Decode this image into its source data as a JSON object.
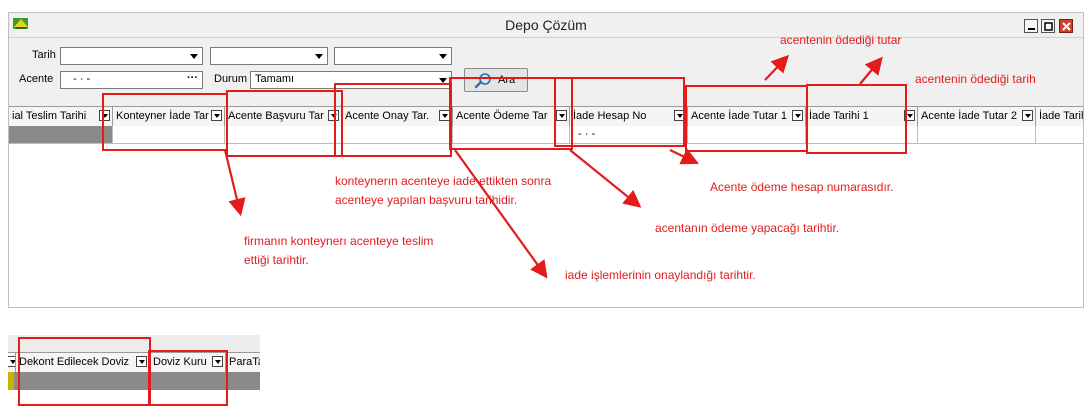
{
  "window": {
    "title": "Depo Çözüm"
  },
  "filters": {
    "date_label": "Tarih",
    "date_combo_1": "",
    "date_combo_2": "",
    "date_combo_3": "",
    "agency_label": "Acente",
    "agency_value": "- · -",
    "agency_browse": "···",
    "status_label": "Durum",
    "status_value": "Tamamı",
    "search_button": "Ara"
  },
  "grid": {
    "columns": [
      "ial Teslim Tarihi",
      "Konteyner İade Tar",
      "Acente Başvuru Tar",
      "Acente Onay Tar.",
      "Acente Ödeme Tar",
      "İade Hesap No",
      "Acente İade Tutar 1",
      "İade Tarihi 1",
      "Acente İade Tutar 2",
      "İade Tarih"
    ],
    "row_value_iade_hesap": "- · -"
  },
  "grid2": {
    "columns": [
      "Dekont Edilecek Doviz",
      "Doviz Kuru",
      "ParaTa"
    ]
  },
  "annotations": {
    "paid_amount": "acentenin ödediği tutar",
    "paid_date": "acentenin ödediği tarih",
    "application_date_line1": "konteynerın acenteye iade ettikten sonra",
    "application_date_line2": "acenteye yapılan başvuru tarihidir.",
    "account_no": "Acente ödeme hesap numarasıdır.",
    "payment_date": "acentanın ödeme yapacağı tarihtir.",
    "delivery_line1": "firmanın konteynerı acenteye teslim",
    "delivery_line2": "ettiği tarihtir.",
    "approval_date": "iade işlemlerinin onaylandığı tarihtir."
  },
  "colors": {
    "annotation": "#e41b1b",
    "window_bg": "#f0f0f0",
    "close_button": "#c8402e"
  },
  "icons": [
    "app-logo-icon",
    "minimize-icon",
    "maximize-icon",
    "close-icon",
    "search-icon",
    "dropdown-arrow-icon"
  ]
}
